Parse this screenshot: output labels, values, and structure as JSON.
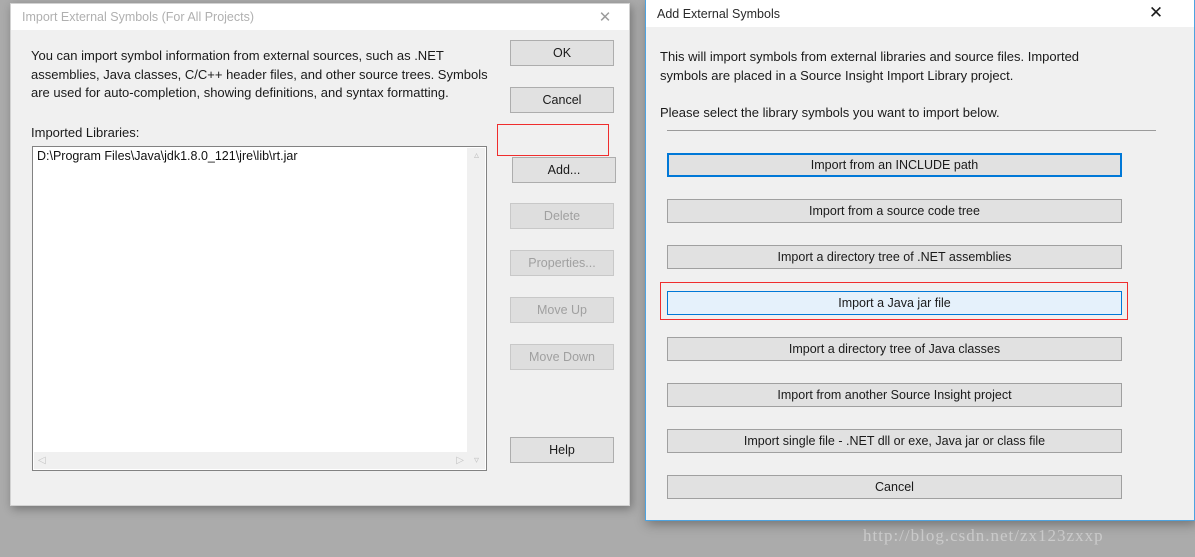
{
  "desktop": {
    "background_color": "#ababab",
    "watermark": "http://blog.csdn.net/zx123zxxp"
  },
  "left_dialog": {
    "title": "Import External Symbols (For All Projects)",
    "close_icon": "close-icon",
    "intro_text": "You can import symbol information from external sources, such as .NET assemblies, Java classes, C/C++ header files, and other source trees. Symbols are used for auto-completion, showing definitions, and syntax formatting.",
    "imported_libraries_label": "Imported Libraries:",
    "listbox": {
      "items": [
        "D:\\Program Files\\Java\\jdk1.8.0_121\\jre\\lib\\rt.jar"
      ],
      "vscroll_up_icon": "chevron-up-icon",
      "vscroll_down_icon": "chevron-down-icon",
      "hscroll_left_icon": "chevron-left-icon",
      "hscroll_right_icon": "chevron-right-icon"
    },
    "buttons": {
      "ok": "OK",
      "cancel": "Cancel",
      "add": "Add...",
      "delete": "Delete",
      "properties": "Properties...",
      "move_up": "Move Up",
      "move_down": "Move Down",
      "help": "Help"
    },
    "disabled_buttons": [
      "delete",
      "properties",
      "move_up",
      "move_down"
    ],
    "annotation": {
      "target": "add",
      "color": "#ef2d2d"
    }
  },
  "right_dialog": {
    "title": "Add External Symbols",
    "close_icon": "close-icon",
    "description_line1": "This will import symbols from external libraries and source files. Imported symbols are placed in a Source Insight Import Library project.",
    "description_line2": "Please select the library symbols you want to import below.",
    "options": [
      {
        "label": "Import from an INCLUDE path",
        "state": "focused"
      },
      {
        "label": "Import from a source code tree",
        "state": "normal"
      },
      {
        "label": "Import a directory tree of .NET assemblies",
        "state": "normal"
      },
      {
        "label": "Import a Java jar file",
        "state": "hovered"
      },
      {
        "label": "Import a directory tree of Java classes",
        "state": "normal"
      },
      {
        "label": "Import from another Source Insight project",
        "state": "normal"
      },
      {
        "label": "Import single file - .NET dll or exe, Java jar or class file",
        "state": "normal"
      },
      {
        "label": "Cancel",
        "state": "normal"
      }
    ],
    "annotation": {
      "target": "Import a Java jar file",
      "color": "#ef2d2d"
    },
    "accent_color": "#0078d7",
    "hover_fill": "#e5f1fb"
  }
}
